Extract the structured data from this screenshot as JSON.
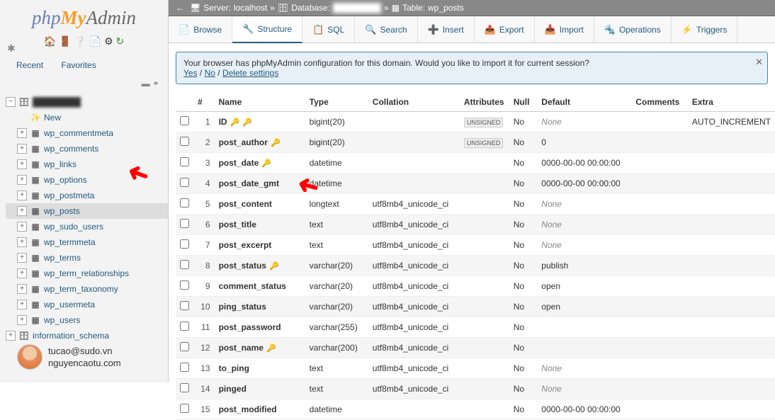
{
  "logo": {
    "part1": "php",
    "part2": "My",
    "part3": "Admin"
  },
  "sidebar_tabs": {
    "recent": "Recent",
    "favorites": "Favorites"
  },
  "tree": {
    "root_expanded": true,
    "db_hidden_label": "████████",
    "new_label": "New",
    "tables": [
      "wp_commentmeta",
      "wp_comments",
      "wp_links",
      "wp_options",
      "wp_postmeta",
      "wp_posts",
      "wp_sudo_users",
      "wp_termmeta",
      "wp_terms",
      "wp_term_relationships",
      "wp_term_taxonomy",
      "wp_usermeta",
      "wp_users"
    ],
    "selected_table": "wp_posts",
    "other_db": "information_schema"
  },
  "avatar": {
    "line1": "tucao@sudo.vn",
    "line2": "nguyencaotu.com"
  },
  "breadcrumb": {
    "server_label": "Server:",
    "server_value": "localhost",
    "db_label": "Database:",
    "db_value": "████████",
    "table_label": "Table:",
    "table_value": "wp_posts",
    "sep": "»"
  },
  "tabs": [
    {
      "icon": "📄",
      "label": "Browse"
    },
    {
      "icon": "🔧",
      "label": "Structure",
      "active": true
    },
    {
      "icon": "📋",
      "label": "SQL"
    },
    {
      "icon": "🔍",
      "label": "Search"
    },
    {
      "icon": "➕",
      "label": "Insert"
    },
    {
      "icon": "📤",
      "label": "Export"
    },
    {
      "icon": "📥",
      "label": "Import"
    },
    {
      "icon": "🔩",
      "label": "Operations"
    },
    {
      "icon": "⚡",
      "label": "Triggers"
    }
  ],
  "notice": {
    "text": "Your browser has phpMyAdmin configuration for this domain. Would you like to import it for current session?",
    "yes": "Yes",
    "no": "No",
    "del": "Delete settings",
    "sep": " / "
  },
  "headers": {
    "num": "#",
    "name": "Name",
    "type": "Type",
    "collation": "Collation",
    "attributes": "Attributes",
    "null": "Null",
    "default": "Default",
    "comments": "Comments",
    "extra": "Extra"
  },
  "columns": [
    {
      "n": 1,
      "name": "ID",
      "pk": true,
      "idx": true,
      "type": "bigint(20)",
      "coll": "",
      "attr": "UNSIGNED",
      "null": "No",
      "def": "None",
      "def_italic": true,
      "extra": "AUTO_INCREMENT"
    },
    {
      "n": 2,
      "name": "post_author",
      "idx": true,
      "type": "bigint(20)",
      "coll": "",
      "attr": "UNSIGNED",
      "null": "No",
      "def": "0"
    },
    {
      "n": 3,
      "name": "post_date",
      "idx": true,
      "type": "datetime",
      "coll": "",
      "attr": "",
      "null": "No",
      "def": "0000-00-00 00:00:00"
    },
    {
      "n": 4,
      "name": "post_date_gmt",
      "type": "datetime",
      "coll": "",
      "attr": "",
      "null": "No",
      "def": "0000-00-00 00:00:00"
    },
    {
      "n": 5,
      "name": "post_content",
      "type": "longtext",
      "coll": "utf8mb4_unicode_ci",
      "attr": "",
      "null": "No",
      "def": "None",
      "def_italic": true
    },
    {
      "n": 6,
      "name": "post_title",
      "type": "text",
      "coll": "utf8mb4_unicode_ci",
      "attr": "",
      "null": "No",
      "def": "None",
      "def_italic": true
    },
    {
      "n": 7,
      "name": "post_excerpt",
      "type": "text",
      "coll": "utf8mb4_unicode_ci",
      "attr": "",
      "null": "No",
      "def": "None",
      "def_italic": true
    },
    {
      "n": 8,
      "name": "post_status",
      "idx": true,
      "type": "varchar(20)",
      "coll": "utf8mb4_unicode_ci",
      "attr": "",
      "null": "No",
      "def": "publish"
    },
    {
      "n": 9,
      "name": "comment_status",
      "type": "varchar(20)",
      "coll": "utf8mb4_unicode_ci",
      "attr": "",
      "null": "No",
      "def": "open"
    },
    {
      "n": 10,
      "name": "ping_status",
      "type": "varchar(20)",
      "coll": "utf8mb4_unicode_ci",
      "attr": "",
      "null": "No",
      "def": "open"
    },
    {
      "n": 11,
      "name": "post_password",
      "type": "varchar(255)",
      "coll": "utf8mb4_unicode_ci",
      "attr": "",
      "null": "No",
      "def": ""
    },
    {
      "n": 12,
      "name": "post_name",
      "idx": true,
      "type": "varchar(200)",
      "coll": "utf8mb4_unicode_ci",
      "attr": "",
      "null": "No",
      "def": ""
    },
    {
      "n": 13,
      "name": "to_ping",
      "type": "text",
      "coll": "utf8mb4_unicode_ci",
      "attr": "",
      "null": "No",
      "def": "None",
      "def_italic": true
    },
    {
      "n": 14,
      "name": "pinged",
      "type": "text",
      "coll": "utf8mb4_unicode_ci",
      "attr": "",
      "null": "No",
      "def": "None",
      "def_italic": true
    },
    {
      "n": 15,
      "name": "post_modified",
      "type": "datetime",
      "coll": "",
      "attr": "",
      "null": "No",
      "def": "0000-00-00 00:00:00"
    }
  ]
}
